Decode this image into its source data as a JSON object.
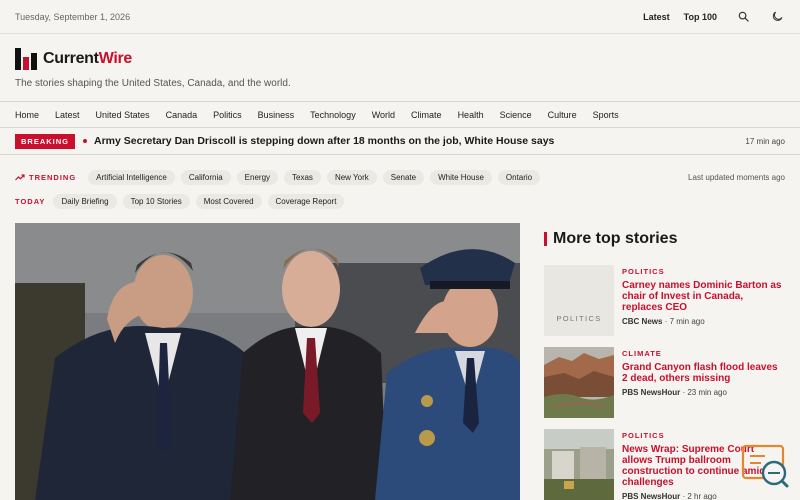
{
  "topbar": {
    "date": "Tuesday, September 1, 2026",
    "links": [
      "Latest",
      "Top 100"
    ],
    "icons": [
      "search-icon",
      "moon-icon"
    ]
  },
  "brand": {
    "name_prefix": "Current",
    "name_suffix": "Wire",
    "tagline": "The stories shaping the United States, Canada, and the world."
  },
  "nav": [
    "Home",
    "Latest",
    "United States",
    "Canada",
    "Politics",
    "Business",
    "Technology",
    "World",
    "Climate",
    "Health",
    "Science",
    "Culture",
    "Sports"
  ],
  "breaking": {
    "badge": "BREAKING",
    "headline": "Army Secretary Dan Driscoll is stepping down after 18 months on the job, White House says",
    "time": "17 min ago"
  },
  "trending": {
    "label": "TRENDING",
    "topics": [
      "Artificial Intelligence",
      "California",
      "Energy",
      "Texas",
      "New York",
      "Senate",
      "White House",
      "Ontario"
    ],
    "updated": "Last updated moments ago"
  },
  "today": {
    "label": "TODAY",
    "items": [
      "Daily Briefing",
      "Top 10 Stories",
      "Most Covered",
      "Coverage Report"
    ]
  },
  "sidebar": {
    "title": "More top stories",
    "stories": [
      {
        "category": "POLITICS",
        "thumb_label": "POLITICS",
        "headline": "Carney names Dominic Barton as chair of Invest in Canada, replaces CEO",
        "source": "CBC News",
        "time": "7 min ago"
      },
      {
        "category": "CLIMATE",
        "headline": "Grand Canyon flash flood leaves 2 dead, others missing",
        "source": "PBS NewsHour",
        "time": "23 min ago"
      },
      {
        "category": "POLITICS",
        "headline": "News Wrap: Supreme Court allows Trump ballroom construction to continue amid challenges",
        "source": "PBS NewsHour",
        "time": "2 hr ago"
      }
    ]
  },
  "colors": {
    "accent": "#c8102e",
    "background": "#f5f4f0"
  }
}
